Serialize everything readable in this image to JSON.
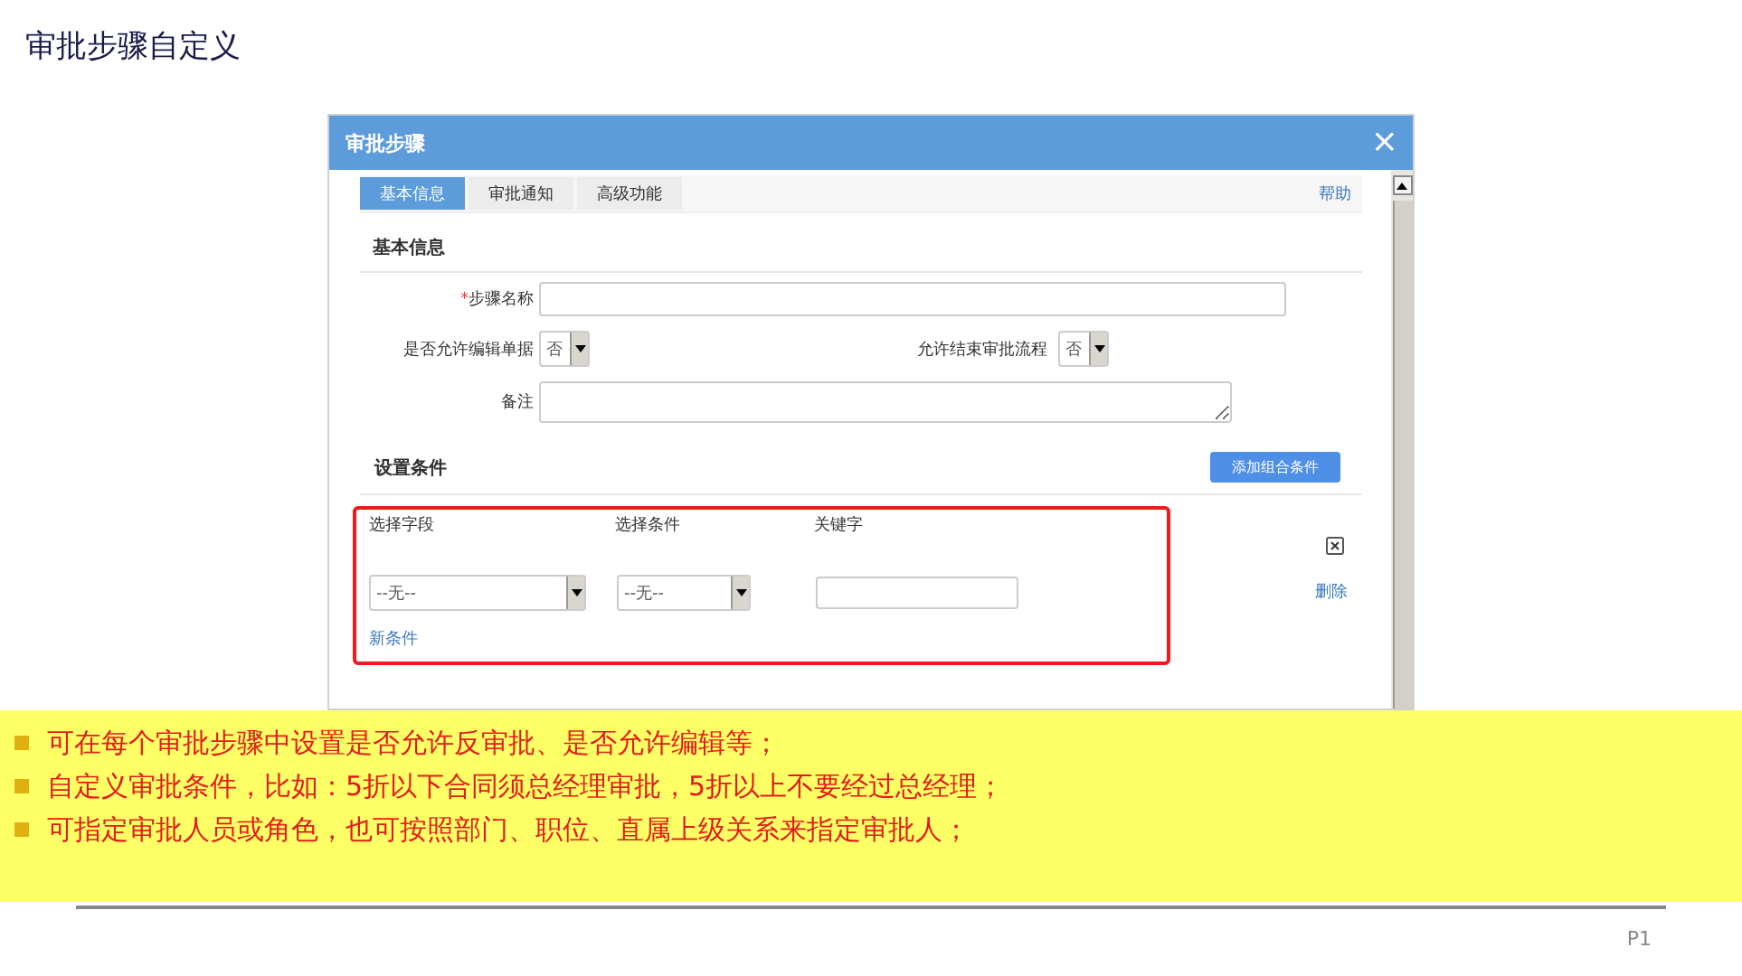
{
  "page_title": "审批步骤自定义",
  "dialog": {
    "title": "审批步骤",
    "close": "×",
    "tabs": [
      {
        "label": "基本信息",
        "selected": true
      },
      {
        "label": "审批通知",
        "selected": false
      },
      {
        "label": "高级功能",
        "selected": false
      }
    ],
    "help": "帮助",
    "basic_section": "基本信息",
    "step_name": {
      "required_mark": "*",
      "label": "步骤名称"
    },
    "allow_edit": {
      "label": "是否允许编辑单据",
      "value": "否"
    },
    "allow_end": {
      "label": "允许结束审批流程",
      "value": "否"
    },
    "remark": {
      "label": "备注"
    },
    "conditions_section": "设置条件",
    "add_group_button": "添加组合条件",
    "condition": {
      "headers": [
        "选择字段",
        "选择条件",
        "关键字"
      ],
      "field_value": "--无--",
      "operator_value": "--无--",
      "new_condition": "新条件",
      "delete": "删除"
    }
  },
  "notes": [
    "可在每个审批步骤中设置是否允许反审批、是否允许编辑等；",
    "自定义审批条件，比如：5折以下合同须总经理审批，5折以上不要经过总经理；",
    "可指定审批人员或角色，也可按照部门、职位、直属上级关系来指定审批人；"
  ],
  "page_number": "P1"
}
